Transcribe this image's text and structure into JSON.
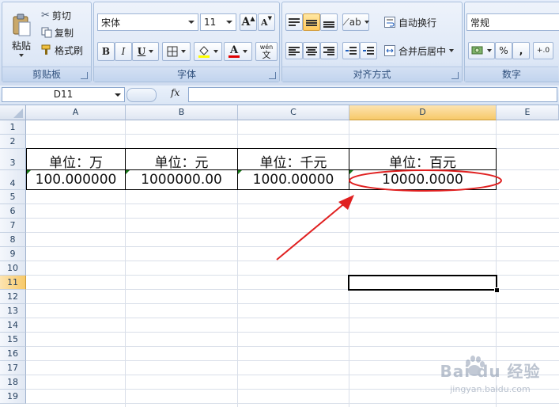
{
  "ribbon": {
    "clipboard": {
      "paste_label": "粘贴",
      "cut_label": "剪切",
      "copy_label": "复制",
      "format_painter_label": "格式刷",
      "group_label": "剪贴板"
    },
    "font": {
      "font_name": "宋体",
      "font_size": "11",
      "grow_label": "A",
      "shrink_label": "A",
      "bold_label": "B",
      "italic_label": "I",
      "underline_label": "U",
      "font_color_label": "A",
      "phonetic_label": "文",
      "phonetic_small": "wén",
      "group_label": "字体"
    },
    "alignment": {
      "wrap_text_label": "自动换行",
      "merge_center_label": "合并后居中",
      "group_label": "对齐方式"
    },
    "number": {
      "format_value": "常规",
      "percent_label": "%",
      "comma_label": ",",
      "increase_decimal_label": "+.0",
      "group_label": "数字"
    }
  },
  "formula_bar": {
    "name_box": "D11",
    "fx_label": "fx",
    "formula": ""
  },
  "sheet": {
    "columns": [
      "A",
      "B",
      "C",
      "D",
      "E"
    ],
    "rows": [
      "1",
      "2",
      "3",
      "4",
      "5",
      "6",
      "7",
      "8",
      "9",
      "10",
      "11",
      "12",
      "13",
      "14",
      "15",
      "16",
      "17",
      "18",
      "19"
    ],
    "selected_cell": "D11",
    "cells": {
      "A3": "单位：万",
      "B3": "单位：元",
      "C3": "单位：千元",
      "D3": "单位：百元",
      "A4": "100.000000",
      "B4": "1000000.00",
      "C4": "1000.00000",
      "D4": "10000.0000"
    }
  },
  "annotation": {
    "color": "#e02020"
  },
  "watermark": {
    "logo_text": "Bai du 经验",
    "url_text": "jingyan.baidu.com"
  },
  "colors": {
    "ribbon_bg": "#dbe6f6",
    "selection_header": "#f7c969",
    "annotation_red": "#e02020"
  }
}
